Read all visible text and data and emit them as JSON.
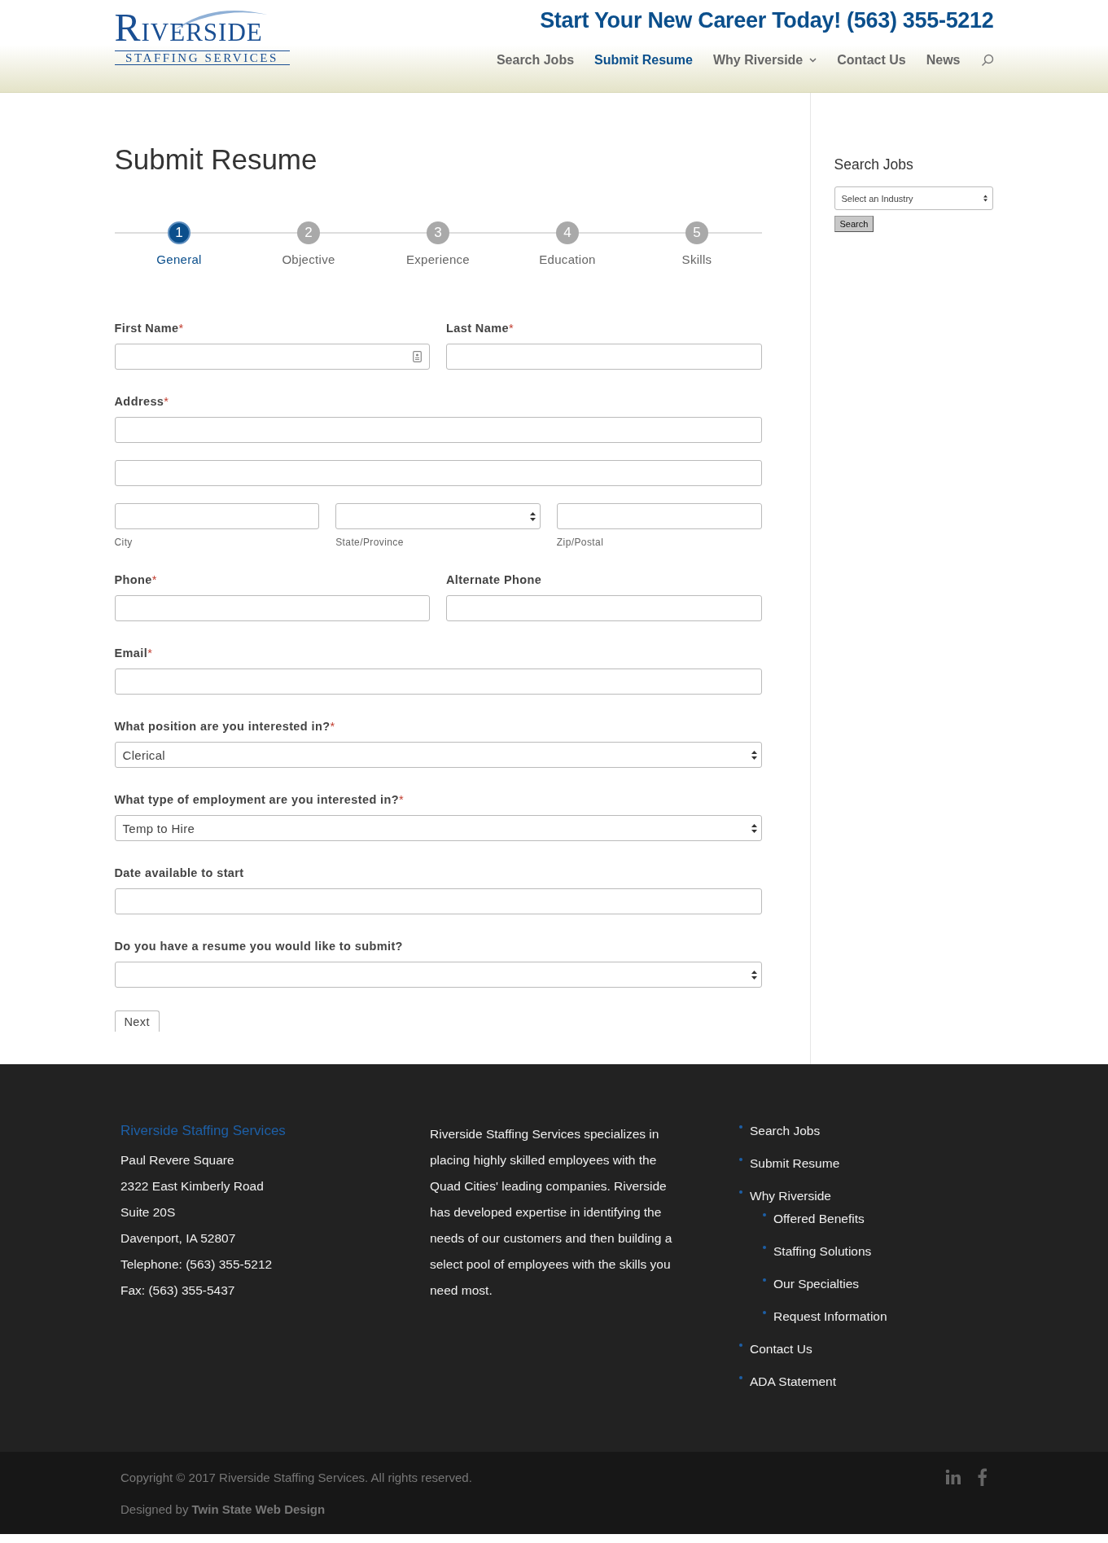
{
  "header": {
    "logo": {
      "name": "RIVERSIDE",
      "tagline": "STAFFING SERVICES"
    },
    "cta": "Start Your New Career Today! (563) 355-5212",
    "nav": [
      {
        "label": "Search Jobs",
        "selected": false
      },
      {
        "label": "Submit Resume",
        "selected": true
      },
      {
        "label": "Why Riverside",
        "selected": false,
        "dropdown": true
      },
      {
        "label": "Contact Us",
        "selected": false
      },
      {
        "label": "News",
        "selected": false
      }
    ]
  },
  "page_title": "Submit Resume",
  "steps": [
    {
      "number": "1",
      "label": "General",
      "selected": true
    },
    {
      "number": "2",
      "label": "Objective",
      "selected": false
    },
    {
      "number": "3",
      "label": "Experience",
      "selected": false
    },
    {
      "number": "4",
      "label": "Education",
      "selected": false
    },
    {
      "number": "5",
      "label": "Skills",
      "selected": false
    }
  ],
  "form": {
    "rows": [
      {
        "kind": "pair",
        "fields": [
          {
            "label": "First Name",
            "required_mark": "*",
            "contact_icon": true
          },
          {
            "label": "Last Name",
            "required_mark": "*"
          }
        ]
      },
      {
        "kind": "address",
        "label": "Address",
        "required_mark": "*",
        "sublabels": [
          "City",
          "State/Province",
          "Zip/Postal"
        ]
      },
      {
        "kind": "pair",
        "fields": [
          {
            "label": "Phone",
            "required_mark": "*"
          },
          {
            "label": "Alternate Phone"
          }
        ]
      },
      {
        "kind": "text",
        "label": "Email",
        "required_mark": "*"
      },
      {
        "kind": "select",
        "label": "What position are you interested in?",
        "required_mark": "*",
        "value": "Clerical"
      },
      {
        "kind": "select",
        "label": "What type of employment are you interested in?",
        "required_mark": "*",
        "value": "Temp to Hire"
      },
      {
        "kind": "text",
        "label": "Date available to start"
      },
      {
        "kind": "select",
        "label": "Do you have a resume you would like to submit?"
      }
    ],
    "next_button": "Next"
  },
  "sidebar": {
    "title": "Search Jobs",
    "select_value": "Select an Industry",
    "button": "Search"
  },
  "footer": {
    "title": "Riverside Staffing Services",
    "address": [
      "Paul Revere Square",
      "2322 East Kimberly Road",
      "Suite 20S",
      "Davenport, IA 52807",
      "Telephone: (563) 355-5212",
      "Fax: (563) 355-5437"
    ],
    "about": "Riverside Staffing Services specializes in placing highly skilled employees with the Quad Cities' leading companies. Riverside has developed expertise in identifying the needs of our customers and then building a select pool of employees with the skills you need most.",
    "links": [
      {
        "label": "Search Jobs"
      },
      {
        "label": "Submit Resume"
      },
      {
        "label": "Why Riverside",
        "children": [
          {
            "label": "Offered Benefits"
          },
          {
            "label": "Staffing Solutions"
          },
          {
            "label": "Our Specialties"
          },
          {
            "label": "Request Information"
          }
        ]
      },
      {
        "label": "Contact Us"
      },
      {
        "label": "ADA Statement"
      }
    ]
  },
  "bottom": {
    "copyright": "Copyright © 2017 Riverside Staffing Services. All rights reserved.",
    "designed_prefix": "Designed by",
    "designer": "Twin State Web Design"
  }
}
